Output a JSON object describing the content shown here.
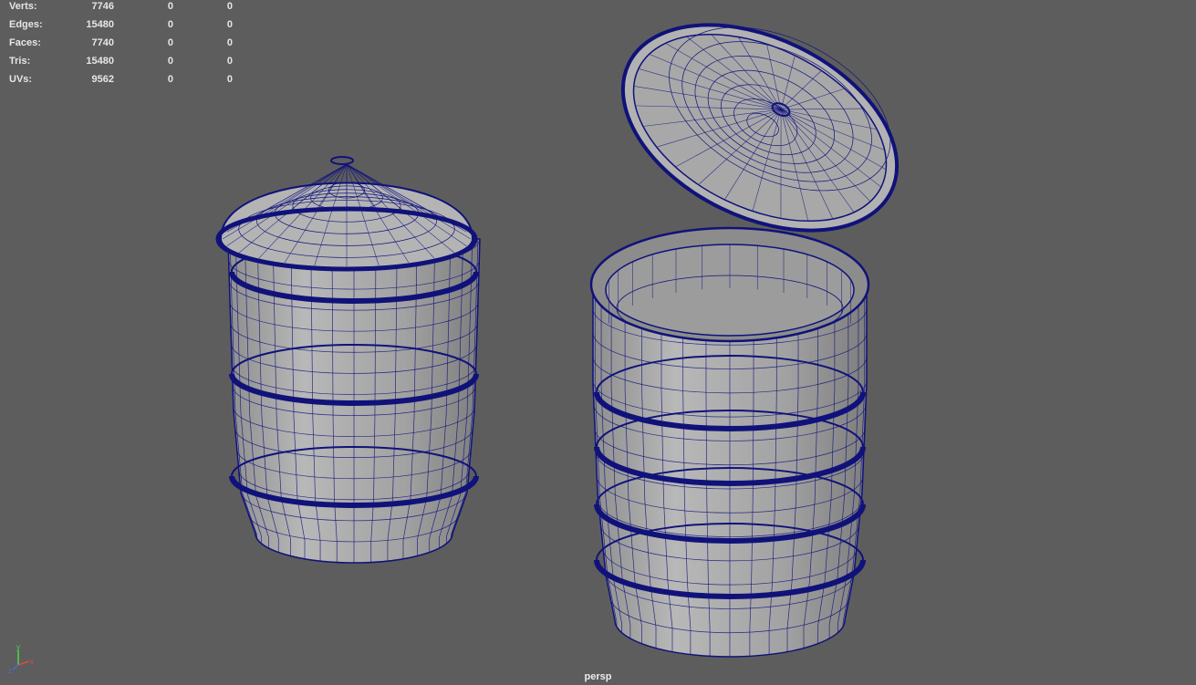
{
  "hud": {
    "rows": [
      {
        "label": "Verts:",
        "total": "7746",
        "selected": "0",
        "uv": "0"
      },
      {
        "label": "Edges:",
        "total": "15480",
        "selected": "0",
        "uv": "0"
      },
      {
        "label": "Faces:",
        "total": "7740",
        "selected": "0",
        "uv": "0"
      },
      {
        "label": "Tris:",
        "total": "15480",
        "selected": "0",
        "uv": "0"
      },
      {
        "label": "UVs:",
        "total": "9562",
        "selected": "0",
        "uv": "0"
      }
    ]
  },
  "camera": {
    "name": "persp"
  },
  "axis_gizmo": {
    "x": "x",
    "y": "y",
    "z": "z"
  },
  "colors": {
    "background": "#5d5d5d",
    "wire": "#10127a",
    "surface": "#a3a3a3",
    "x_axis": "#d94a4a",
    "y_axis": "#4ad94a",
    "z_axis": "#4a6ad9"
  },
  "scene_objects": [
    "closed-barrel",
    "open-barrel",
    "barrel-lid"
  ]
}
